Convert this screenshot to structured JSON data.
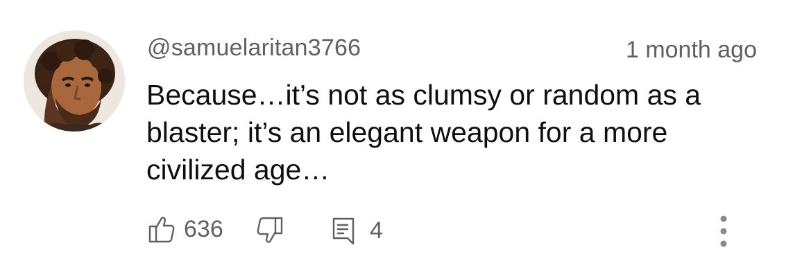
{
  "comment": {
    "author": "@samuelaritan3766",
    "timestamp": "1 month ago",
    "text_lines": [
      "Because…it’s not as clumsy or random as a",
      "blaster; it’s an elegant weapon for a more",
      "civilized age…"
    ],
    "like_count": "636",
    "reply_count": "4",
    "icons": {
      "like": "thumbs-up-icon",
      "dislike": "thumbs-down-icon",
      "reply": "comment-icon",
      "more": "more-vertical-icon"
    },
    "colors": {
      "text": "#0f0f0f",
      "secondary": "#606060",
      "background": "#ffffff"
    }
  }
}
